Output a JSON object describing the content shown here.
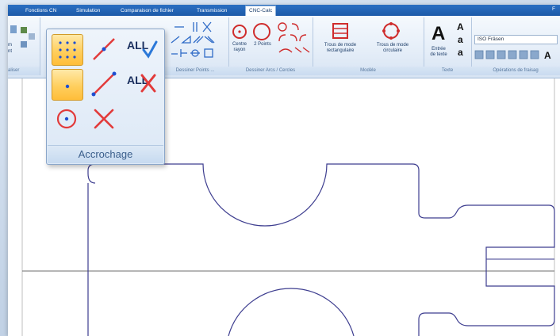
{
  "tabs": [
    {
      "label": "Fonctions CN",
      "active": false
    },
    {
      "label": "Simulation",
      "active": false
    },
    {
      "label": "Comparaison de fichier",
      "active": false
    },
    {
      "label": "Transmission",
      "active": false
    },
    {
      "label": "CNC-Calc",
      "active": true
    }
  ],
  "tab_right": "F",
  "ribbon": {
    "groups": {
      "dessiner_points": "Dessiner Points ...",
      "dessiner_arcs": "Dessiner Arcs / Cercles",
      "modele": "Modèle",
      "texte": "Texte",
      "operations": "Opérations de fraisag"
    },
    "left_fragment": {
      "a": "m",
      "b": "nt",
      "c": "aliser"
    },
    "arcs": {
      "centre_rayon": "Centre\nrayon",
      "two_points": "2 Points"
    },
    "modele": {
      "trous_rect": "Trous de mode\nrectangulaire",
      "trous_circ": "Trous de mode\ncirculaire"
    },
    "texte": {
      "entree": "Entrée\nde texte"
    },
    "operations": {
      "select_value": "ISO Fräsen"
    }
  },
  "snap_panel": {
    "title": "Accrochage",
    "buttons": [
      {
        "name": "grid-points-snap",
        "active": true
      },
      {
        "name": "line-snap",
        "active": false
      },
      {
        "name": "all-snap-on",
        "label": "ALL",
        "active": false
      },
      {
        "name": "point-snap",
        "active": true
      },
      {
        "name": "line-point-snap",
        "active": false
      },
      {
        "name": "all-snap-off",
        "label": "ALL",
        "active": false
      },
      {
        "name": "circle-center-snap",
        "active": false
      },
      {
        "name": "intersection-snap",
        "active": false
      }
    ]
  },
  "colors": {
    "ribbon_tab_bg": "#1d5aa8",
    "snap_active": "#ffcf5e",
    "geometry_stroke": "#3d3d8f",
    "axis_stroke": "#6e6e6e",
    "accent_red": "#e23a3a",
    "accent_blue": "#1e4fd1"
  }
}
